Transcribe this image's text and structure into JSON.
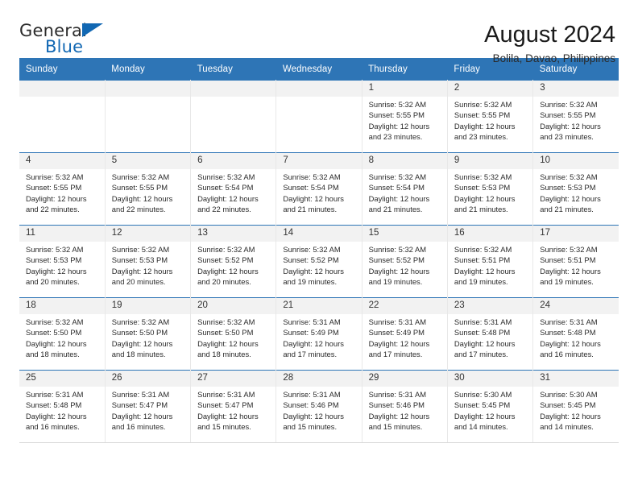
{
  "brand": {
    "name_part1": "General",
    "name_part2": "Blue",
    "flag_icon": "blue-triangle-flag-icon",
    "accent_color": "#1268b3"
  },
  "header": {
    "title": "August 2024",
    "subtitle": "Bolila, Davao, Philippines"
  },
  "theme": {
    "header_blue": "#2e75b6",
    "daynum_gray": "#f2f2f2",
    "text": "#2a2a2a"
  },
  "calendar": {
    "day_headers": [
      "Sunday",
      "Monday",
      "Tuesday",
      "Wednesday",
      "Thursday",
      "Friday",
      "Saturday"
    ],
    "weeks": [
      [
        {
          "day": "",
          "empty": true,
          "sunrise": "",
          "sunset": "",
          "daylight_line1": "",
          "daylight_line2": ""
        },
        {
          "day": "",
          "empty": true,
          "sunrise": "",
          "sunset": "",
          "daylight_line1": "",
          "daylight_line2": ""
        },
        {
          "day": "",
          "empty": true,
          "sunrise": "",
          "sunset": "",
          "daylight_line1": "",
          "daylight_line2": ""
        },
        {
          "day": "",
          "empty": true,
          "sunrise": "",
          "sunset": "",
          "daylight_line1": "",
          "daylight_line2": ""
        },
        {
          "day": "1",
          "empty": false,
          "sunrise": "Sunrise: 5:32 AM",
          "sunset": "Sunset: 5:55 PM",
          "daylight_line1": "Daylight: 12 hours",
          "daylight_line2": "and 23 minutes."
        },
        {
          "day": "2",
          "empty": false,
          "sunrise": "Sunrise: 5:32 AM",
          "sunset": "Sunset: 5:55 PM",
          "daylight_line1": "Daylight: 12 hours",
          "daylight_line2": "and 23 minutes."
        },
        {
          "day": "3",
          "empty": false,
          "sunrise": "Sunrise: 5:32 AM",
          "sunset": "Sunset: 5:55 PM",
          "daylight_line1": "Daylight: 12 hours",
          "daylight_line2": "and 23 minutes."
        }
      ],
      [
        {
          "day": "4",
          "empty": false,
          "sunrise": "Sunrise: 5:32 AM",
          "sunset": "Sunset: 5:55 PM",
          "daylight_line1": "Daylight: 12 hours",
          "daylight_line2": "and 22 minutes."
        },
        {
          "day": "5",
          "empty": false,
          "sunrise": "Sunrise: 5:32 AM",
          "sunset": "Sunset: 5:55 PM",
          "daylight_line1": "Daylight: 12 hours",
          "daylight_line2": "and 22 minutes."
        },
        {
          "day": "6",
          "empty": false,
          "sunrise": "Sunrise: 5:32 AM",
          "sunset": "Sunset: 5:54 PM",
          "daylight_line1": "Daylight: 12 hours",
          "daylight_line2": "and 22 minutes."
        },
        {
          "day": "7",
          "empty": false,
          "sunrise": "Sunrise: 5:32 AM",
          "sunset": "Sunset: 5:54 PM",
          "daylight_line1": "Daylight: 12 hours",
          "daylight_line2": "and 21 minutes."
        },
        {
          "day": "8",
          "empty": false,
          "sunrise": "Sunrise: 5:32 AM",
          "sunset": "Sunset: 5:54 PM",
          "daylight_line1": "Daylight: 12 hours",
          "daylight_line2": "and 21 minutes."
        },
        {
          "day": "9",
          "empty": false,
          "sunrise": "Sunrise: 5:32 AM",
          "sunset": "Sunset: 5:53 PM",
          "daylight_line1": "Daylight: 12 hours",
          "daylight_line2": "and 21 minutes."
        },
        {
          "day": "10",
          "empty": false,
          "sunrise": "Sunrise: 5:32 AM",
          "sunset": "Sunset: 5:53 PM",
          "daylight_line1": "Daylight: 12 hours",
          "daylight_line2": "and 21 minutes."
        }
      ],
      [
        {
          "day": "11",
          "empty": false,
          "sunrise": "Sunrise: 5:32 AM",
          "sunset": "Sunset: 5:53 PM",
          "daylight_line1": "Daylight: 12 hours",
          "daylight_line2": "and 20 minutes."
        },
        {
          "day": "12",
          "empty": false,
          "sunrise": "Sunrise: 5:32 AM",
          "sunset": "Sunset: 5:53 PM",
          "daylight_line1": "Daylight: 12 hours",
          "daylight_line2": "and 20 minutes."
        },
        {
          "day": "13",
          "empty": false,
          "sunrise": "Sunrise: 5:32 AM",
          "sunset": "Sunset: 5:52 PM",
          "daylight_line1": "Daylight: 12 hours",
          "daylight_line2": "and 20 minutes."
        },
        {
          "day": "14",
          "empty": false,
          "sunrise": "Sunrise: 5:32 AM",
          "sunset": "Sunset: 5:52 PM",
          "daylight_line1": "Daylight: 12 hours",
          "daylight_line2": "and 19 minutes."
        },
        {
          "day": "15",
          "empty": false,
          "sunrise": "Sunrise: 5:32 AM",
          "sunset": "Sunset: 5:52 PM",
          "daylight_line1": "Daylight: 12 hours",
          "daylight_line2": "and 19 minutes."
        },
        {
          "day": "16",
          "empty": false,
          "sunrise": "Sunrise: 5:32 AM",
          "sunset": "Sunset: 5:51 PM",
          "daylight_line1": "Daylight: 12 hours",
          "daylight_line2": "and 19 minutes."
        },
        {
          "day": "17",
          "empty": false,
          "sunrise": "Sunrise: 5:32 AM",
          "sunset": "Sunset: 5:51 PM",
          "daylight_line1": "Daylight: 12 hours",
          "daylight_line2": "and 19 minutes."
        }
      ],
      [
        {
          "day": "18",
          "empty": false,
          "sunrise": "Sunrise: 5:32 AM",
          "sunset": "Sunset: 5:50 PM",
          "daylight_line1": "Daylight: 12 hours",
          "daylight_line2": "and 18 minutes."
        },
        {
          "day": "19",
          "empty": false,
          "sunrise": "Sunrise: 5:32 AM",
          "sunset": "Sunset: 5:50 PM",
          "daylight_line1": "Daylight: 12 hours",
          "daylight_line2": "and 18 minutes."
        },
        {
          "day": "20",
          "empty": false,
          "sunrise": "Sunrise: 5:32 AM",
          "sunset": "Sunset: 5:50 PM",
          "daylight_line1": "Daylight: 12 hours",
          "daylight_line2": "and 18 minutes."
        },
        {
          "day": "21",
          "empty": false,
          "sunrise": "Sunrise: 5:31 AM",
          "sunset": "Sunset: 5:49 PM",
          "daylight_line1": "Daylight: 12 hours",
          "daylight_line2": "and 17 minutes."
        },
        {
          "day": "22",
          "empty": false,
          "sunrise": "Sunrise: 5:31 AM",
          "sunset": "Sunset: 5:49 PM",
          "daylight_line1": "Daylight: 12 hours",
          "daylight_line2": "and 17 minutes."
        },
        {
          "day": "23",
          "empty": false,
          "sunrise": "Sunrise: 5:31 AM",
          "sunset": "Sunset: 5:48 PM",
          "daylight_line1": "Daylight: 12 hours",
          "daylight_line2": "and 17 minutes."
        },
        {
          "day": "24",
          "empty": false,
          "sunrise": "Sunrise: 5:31 AM",
          "sunset": "Sunset: 5:48 PM",
          "daylight_line1": "Daylight: 12 hours",
          "daylight_line2": "and 16 minutes."
        }
      ],
      [
        {
          "day": "25",
          "empty": false,
          "sunrise": "Sunrise: 5:31 AM",
          "sunset": "Sunset: 5:48 PM",
          "daylight_line1": "Daylight: 12 hours",
          "daylight_line2": "and 16 minutes."
        },
        {
          "day": "26",
          "empty": false,
          "sunrise": "Sunrise: 5:31 AM",
          "sunset": "Sunset: 5:47 PM",
          "daylight_line1": "Daylight: 12 hours",
          "daylight_line2": "and 16 minutes."
        },
        {
          "day": "27",
          "empty": false,
          "sunrise": "Sunrise: 5:31 AM",
          "sunset": "Sunset: 5:47 PM",
          "daylight_line1": "Daylight: 12 hours",
          "daylight_line2": "and 15 minutes."
        },
        {
          "day": "28",
          "empty": false,
          "sunrise": "Sunrise: 5:31 AM",
          "sunset": "Sunset: 5:46 PM",
          "daylight_line1": "Daylight: 12 hours",
          "daylight_line2": "and 15 minutes."
        },
        {
          "day": "29",
          "empty": false,
          "sunrise": "Sunrise: 5:31 AM",
          "sunset": "Sunset: 5:46 PM",
          "daylight_line1": "Daylight: 12 hours",
          "daylight_line2": "and 15 minutes."
        },
        {
          "day": "30",
          "empty": false,
          "sunrise": "Sunrise: 5:30 AM",
          "sunset": "Sunset: 5:45 PM",
          "daylight_line1": "Daylight: 12 hours",
          "daylight_line2": "and 14 minutes."
        },
        {
          "day": "31",
          "empty": false,
          "sunrise": "Sunrise: 5:30 AM",
          "sunset": "Sunset: 5:45 PM",
          "daylight_line1": "Daylight: 12 hours",
          "daylight_line2": "and 14 minutes."
        }
      ]
    ]
  }
}
